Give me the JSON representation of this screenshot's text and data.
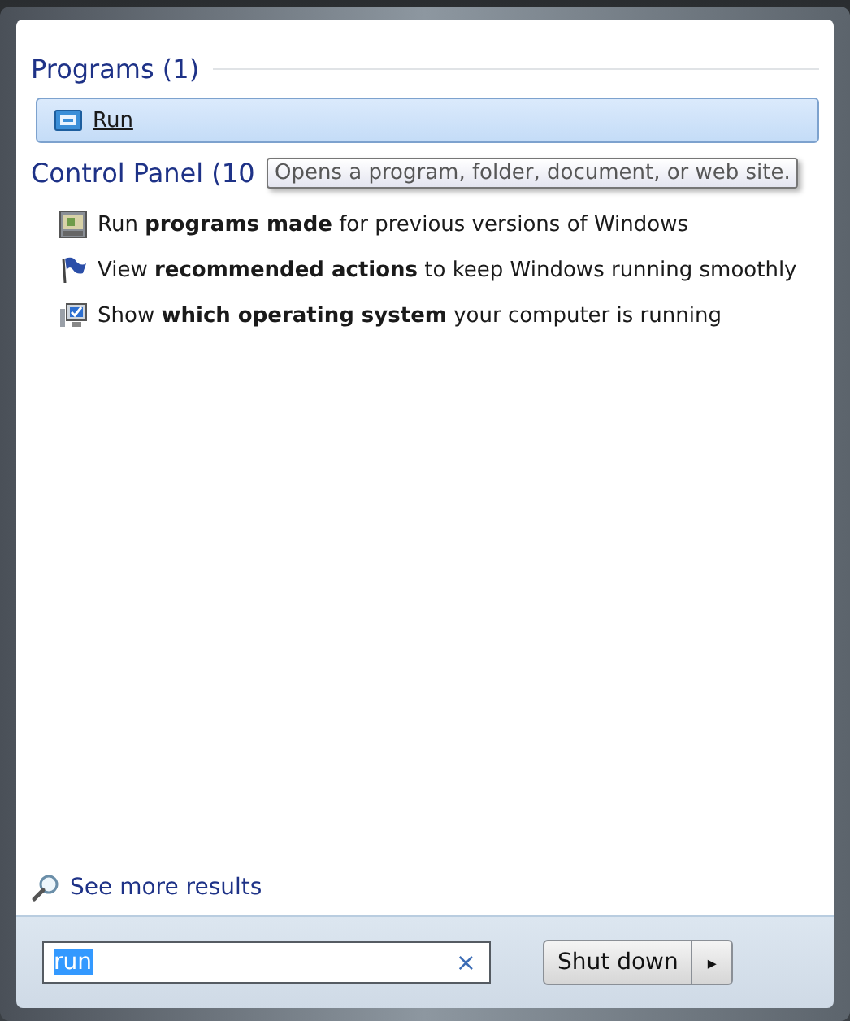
{
  "groups": [
    {
      "heading": "Programs (1)",
      "kind": "programs",
      "items": [
        {
          "label": "Run",
          "selected": true
        }
      ]
    },
    {
      "heading": "Control Panel (10",
      "kind": "control",
      "items": [
        {
          "label": "Run **programs made** for previous versions of Windows",
          "selected": false
        },
        {
          "label": "View **recommended actions** to keep Windows running smoothly",
          "selected": false
        },
        {
          "label": "Show **which operating system** your computer is running",
          "selected": false
        }
      ]
    }
  ],
  "tooltip": "Opens a program, folder, document, or web site.",
  "see_more": "See more results",
  "search": {
    "value": "run",
    "value_selected": true,
    "clear": "×"
  },
  "shutdown": {
    "label": "Shut down",
    "arrow": "▸"
  }
}
